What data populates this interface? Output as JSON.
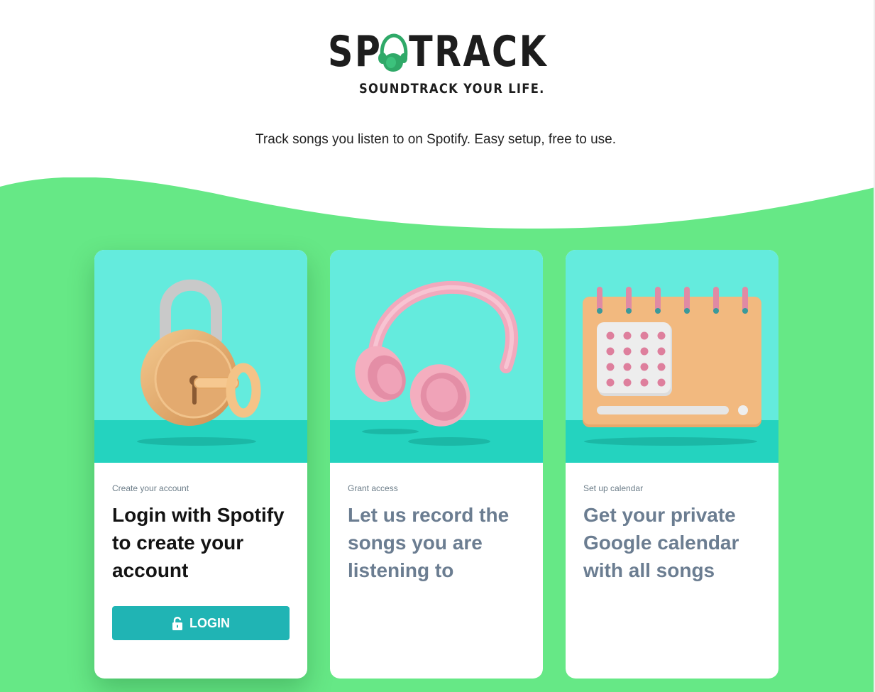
{
  "brand": {
    "logo_left": "SP",
    "logo_right": "TRACK",
    "tagline": "SOUNDTRACK YOUR LIFE.",
    "subtitle": "Track songs you listen to on Spotify. Easy setup, free to use."
  },
  "colors": {
    "wave_green": "#66e886",
    "card_art_bg": "#64ebdd",
    "card_art_floor": "#24d3bf",
    "button": "#20b4b4",
    "logo_green": "#2fa968"
  },
  "cards": [
    {
      "eyebrow": "Create your account",
      "title": "Login with Spotify to create your account",
      "icon": "padlock-key-icon",
      "button": {
        "label": "LOGIN",
        "icon": "lock-icon"
      }
    },
    {
      "eyebrow": "Grant access",
      "title": "Let us record the songs you are listening to",
      "icon": "headphones-icon"
    },
    {
      "eyebrow": "Set up calendar",
      "title": "Get your private Google calendar with all songs",
      "icon": "calendar-icon"
    }
  ]
}
